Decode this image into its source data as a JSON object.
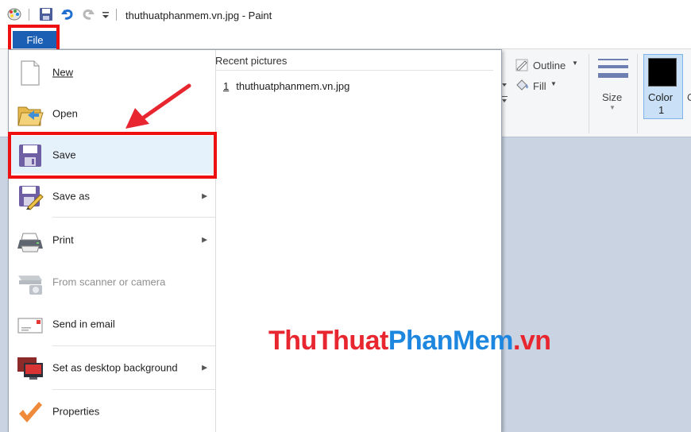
{
  "window": {
    "title": "thuthuatphanmem.vn.jpg - Paint"
  },
  "quick_access": {
    "items": [
      "paint-app-icon",
      "save-icon",
      "undo-icon",
      "redo-icon",
      "customize-dropdown-icon"
    ]
  },
  "ribbon": {
    "file_tab_label": "File",
    "outline_label": "Outline",
    "fill_label": "Fill",
    "size_label": "Size",
    "color1_label": "Color",
    "color1_number": "1",
    "color1_value": "#000000",
    "color2_partial": "C"
  },
  "file_menu": {
    "items": [
      {
        "label": "New",
        "icon": "new-document-icon",
        "has_submenu": false,
        "enabled": true
      },
      {
        "label": "Open",
        "icon": "open-folder-icon",
        "has_submenu": false,
        "enabled": true
      },
      {
        "label": "Save",
        "icon": "save-disk-icon",
        "has_submenu": false,
        "enabled": true
      },
      {
        "label": "Save as",
        "icon": "save-as-icon",
        "has_submenu": true,
        "enabled": true
      },
      {
        "label": "Print",
        "icon": "printer-icon",
        "has_submenu": true,
        "enabled": true
      },
      {
        "label": "From scanner or camera",
        "icon": "scanner-camera-icon",
        "has_submenu": false,
        "enabled": false
      },
      {
        "label": "Send in email",
        "icon": "email-icon",
        "has_submenu": false,
        "enabled": true
      },
      {
        "label": "Set as desktop background",
        "icon": "desktop-background-icon",
        "has_submenu": true,
        "enabled": true
      },
      {
        "label": "Properties",
        "icon": "properties-check-icon",
        "has_submenu": false,
        "enabled": true
      }
    ],
    "submenu_arrow": "▶",
    "recent_pictures": {
      "header": "Recent pictures",
      "items": [
        {
          "number": "1",
          "name": "thuthuatphanmem.vn.jpg"
        }
      ]
    }
  },
  "annotations": {
    "highlight_color": "#ee1010",
    "arrow_color": "#e8262f"
  },
  "watermark": {
    "part1": "ThuThuat",
    "part2": "PhanMem",
    "part3": ".vn",
    "color1": "#e8262f",
    "color2": "#1d87e0"
  }
}
